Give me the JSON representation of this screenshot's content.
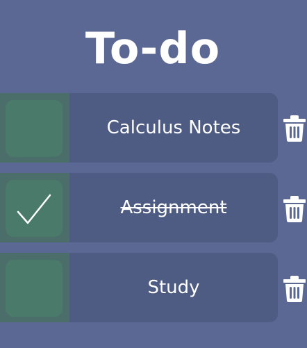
{
  "title": "To-do",
  "todos": [
    {
      "label": "Calculus Notes",
      "done": false
    },
    {
      "label": "Assignment",
      "done": true
    },
    {
      "label": "Study",
      "done": false
    }
  ],
  "colors": {
    "background": "#5b6894",
    "row": "#4e5b82",
    "checkbox": "#4a7a6a",
    "text": "#ffffff"
  },
  "icons": {
    "delete": "trash-icon",
    "done": "checkmark-icon"
  }
}
